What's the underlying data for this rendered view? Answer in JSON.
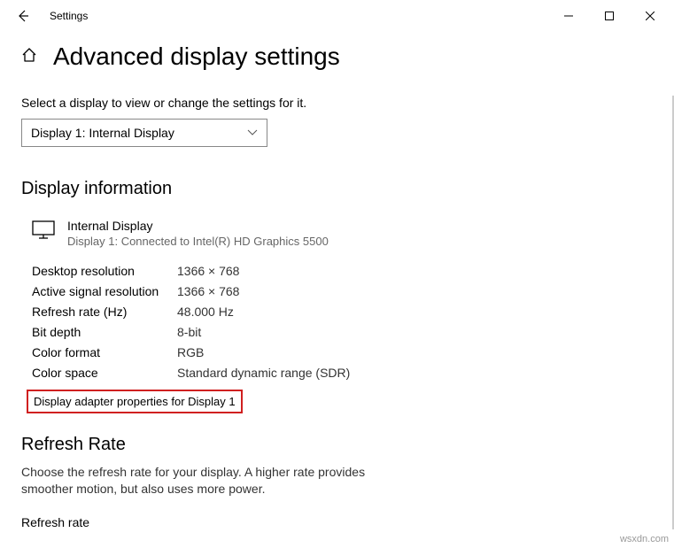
{
  "titlebar": {
    "title": "Settings"
  },
  "page": {
    "title": "Advanced display settings"
  },
  "instruction": "Select a display to view or change the settings for it.",
  "dropdown": {
    "selected": "Display 1: Internal Display"
  },
  "section_info_title": "Display information",
  "display": {
    "name": "Internal Display",
    "subtitle": "Display 1: Connected to Intel(R) HD Graphics 5500"
  },
  "props": [
    {
      "label": "Desktop resolution",
      "value": "1366 × 768"
    },
    {
      "label": "Active signal resolution",
      "value": "1366 × 768"
    },
    {
      "label": "Refresh rate (Hz)",
      "value": "48.000 Hz"
    },
    {
      "label": "Bit depth",
      "value": "8-bit"
    },
    {
      "label": "Color format",
      "value": "RGB"
    },
    {
      "label": "Color space",
      "value": "Standard dynamic range (SDR)"
    }
  ],
  "adapter_link": "Display adapter properties for Display 1",
  "refresh": {
    "title": "Refresh Rate",
    "desc": "Choose the refresh rate for your display. A higher rate provides smoother motion, but also uses more power.",
    "label": "Refresh rate"
  },
  "watermark": "wsxdn.com"
}
